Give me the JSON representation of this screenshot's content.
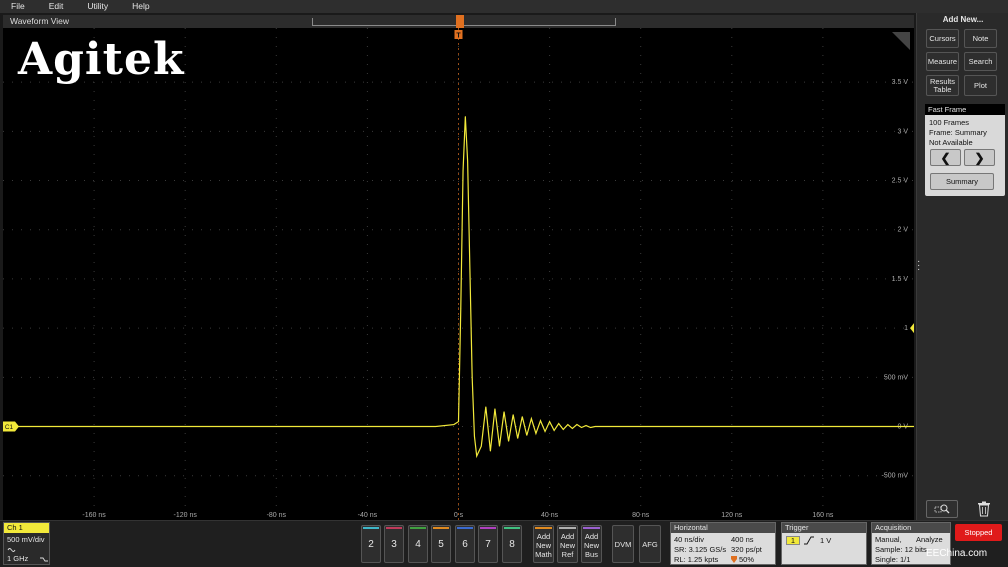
{
  "menu": [
    "File",
    "Edit",
    "Utility",
    "Help"
  ],
  "waveform_view": {
    "title": "Waveform View",
    "watermark": "Agitek",
    "trigger_marker": "T",
    "channel_marker": "C1",
    "ref_marker": "1"
  },
  "colors": {
    "trace": "#f2e93a",
    "background": "#000000",
    "grid": "#3a3a3a",
    "trigger": "#e07020",
    "stopped": "#e01a1a",
    "ch2": "#3fb6c8",
    "ch3": "#c03a5a",
    "ch4": "#40a040",
    "ch5": "#e08a20",
    "ch6": "#3a6ad0",
    "ch7": "#b040c0",
    "ch8": "#40c080",
    "math": "#e08a20",
    "ref": "#b0b0b0",
    "bus": "#9a60d0"
  },
  "chart_data": {
    "type": "line",
    "title": "",
    "x_unit": "ns",
    "y_unit": "V",
    "x_ticks": [
      "-160 ns",
      "-120 ns",
      "-80 ns",
      "-40 ns",
      "0 s",
      "40 ns",
      "80 ns",
      "120 ns",
      "160 ns"
    ],
    "x_tick_values": [
      -160,
      -120,
      -80,
      -40,
      0,
      40,
      80,
      120,
      160
    ],
    "y_ticks": [
      "3.5 V",
      "3 V",
      "2.5 V",
      "2 V",
      "1.5 V",
      "1",
      "500 mV",
      "0 V",
      "-500 mV"
    ],
    "y_tick_values": [
      3.5,
      3.0,
      2.5,
      2.0,
      1.5,
      1.0,
      0.5,
      0.0,
      -0.5
    ],
    "xlim": [
      -200,
      200
    ],
    "ylim": [
      -0.95,
      4.05
    ],
    "grid": true,
    "series": [
      {
        "x": [
          -200,
          -10,
          -2,
          0,
          1,
          2,
          3,
          4,
          5,
          6,
          7,
          8,
          10,
          12,
          14,
          16,
          18,
          20,
          22,
          24,
          26,
          28,
          30,
          32,
          34,
          36,
          38,
          40,
          42,
          44,
          46,
          48,
          50,
          52,
          54,
          56,
          58,
          60,
          64,
          68,
          72,
          80,
          200
        ],
        "y": [
          0.0,
          0.0,
          0.02,
          0.05,
          1.2,
          2.6,
          3.15,
          2.7,
          1.6,
          0.5,
          -0.1,
          -0.3,
          -0.2,
          0.2,
          -0.25,
          0.18,
          -0.2,
          0.15,
          -0.15,
          0.12,
          -0.12,
          0.1,
          -0.09,
          0.08,
          -0.07,
          0.06,
          -0.05,
          0.05,
          -0.04,
          0.03,
          -0.03,
          0.02,
          -0.02,
          0.02,
          -0.01,
          0.01,
          -0.01,
          0.0,
          0.0,
          0.0,
          0.0,
          0.0,
          0.0
        ]
      }
    ]
  },
  "right_panel": {
    "add_new_title": "Add New...",
    "buttons": [
      "Cursors",
      "Note",
      "Measure",
      "Search",
      "Results Table",
      "Plot"
    ],
    "fast_frame": {
      "title": "Fast Frame",
      "frames": "100 Frames",
      "frame": "Frame: Summary",
      "status": "Not Available",
      "prev": "❮",
      "next": "❯",
      "summary": "Summary"
    }
  },
  "ch1": {
    "label": "Ch 1",
    "scale": "500 mV/div",
    "bandwidth": "1 GHz"
  },
  "channels": [
    "2",
    "3",
    "4",
    "5",
    "6",
    "7",
    "8"
  ],
  "add_buttons": [
    {
      "line1": "Add",
      "line2": "New",
      "line3": "Math"
    },
    {
      "line1": "Add",
      "line2": "New",
      "line3": "Ref"
    },
    {
      "line1": "Add",
      "line2": "New",
      "line3": "Bus"
    }
  ],
  "side_buttons": [
    "DVM",
    "AFG"
  ],
  "horizontal": {
    "title": "Horizontal",
    "scale": "40 ns/div",
    "position": "400 ns",
    "sample_rate": "SR: 3.125 GS/s",
    "resolution": "320 ps/pt",
    "record_length": "RL: 1.25 kpts",
    "trigger_pos": "50%"
  },
  "trigger": {
    "title": "Trigger",
    "source": "1",
    "level": "1 V"
  },
  "acquisition": {
    "title": "Acquisition",
    "mode": "Manual,",
    "analyze": "Analyze",
    "sample": "Sample: 12 bits",
    "single": "Single: 1/1"
  },
  "run_state": "Stopped",
  "footer_watermark": "EEChina.com"
}
